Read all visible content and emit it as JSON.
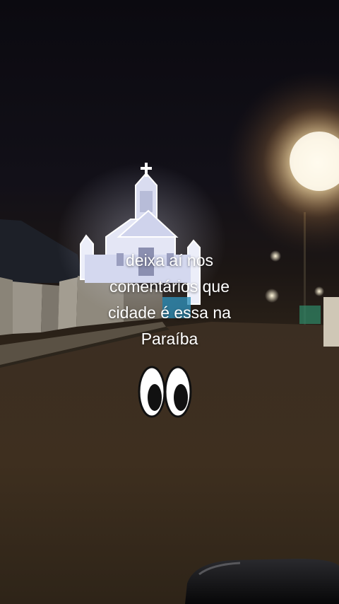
{
  "story": {
    "caption_lines": [
      "deixa aí nos",
      "comentários que",
      "cidade é essa na",
      "Paraíba"
    ],
    "sticker": "eyes-emoji"
  },
  "colors": {
    "night_sky": "#0b0a10",
    "road": "#3a2c1c",
    "church_light": "#f4f2ff",
    "street_light": "#fff2cf",
    "caption_text": "#ffffff"
  }
}
